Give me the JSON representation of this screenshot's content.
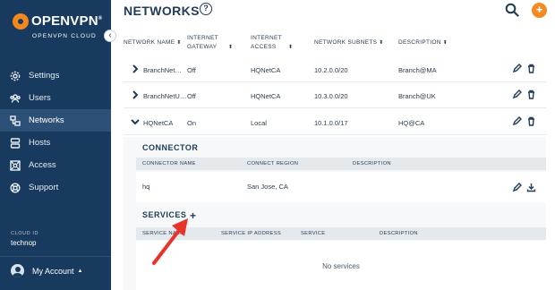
{
  "brand": {
    "name": "OPENVPN",
    "registered": "®",
    "subtitle": "OPENVPN CLOUD"
  },
  "sidebar": {
    "items": [
      {
        "label": "Settings",
        "icon": "gear-icon"
      },
      {
        "label": "Users",
        "icon": "users-icon"
      },
      {
        "label": "Networks",
        "icon": "networks-icon",
        "active": true
      },
      {
        "label": "Hosts",
        "icon": "hosts-icon"
      },
      {
        "label": "Access",
        "icon": "access-icon"
      },
      {
        "label": "Support",
        "icon": "support-icon"
      }
    ],
    "cloud_id_label": "CLOUD ID",
    "cloud_id": "technop",
    "account_label": "My Account"
  },
  "header": {
    "title": "NETWORKS",
    "help": "?",
    "add": "+"
  },
  "table": {
    "columns": [
      {
        "label": "NETWORK NAME",
        "sortable": true
      },
      {
        "label": "INTERNET GATEWAY",
        "sortable": true
      },
      {
        "label": "INTERNET ACCESS",
        "sortable": true
      },
      {
        "label": "NETWORK SUBNETS",
        "sortable": true
      },
      {
        "label": "DESCRIPTION",
        "sortable": true
      }
    ],
    "rows": [
      {
        "name": "BranchNet…",
        "gateway": "Off",
        "access": "HQNetCA",
        "subnets": "10.2.0.0/20",
        "description": "Branch@MA",
        "expanded": false
      },
      {
        "name": "BranchNetU…",
        "gateway": "Off",
        "access": "HQNetCA",
        "subnets": "10.3.0.0/20",
        "description": "Branch@UK",
        "expanded": false
      },
      {
        "name": "HQNetCA",
        "gateway": "On",
        "access": "Local",
        "subnets": "10.1.0.0/17",
        "description": "HQ@CA",
        "expanded": true
      }
    ]
  },
  "connector": {
    "title": "CONNECTOR",
    "columns": [
      "CONNECTOR NAME",
      "CONNECT REGION",
      "DESCRIPTION"
    ],
    "rows": [
      {
        "name": "hq",
        "region": "San Jose, CA",
        "description": ""
      }
    ]
  },
  "services": {
    "title": "SERVICES",
    "add": "+",
    "columns": [
      "SERVICE NAME",
      "SERVICE IP ADDRESS",
      "SERVICE",
      "DESCRIPTION"
    ],
    "empty": "No services"
  },
  "colors": {
    "sidebar": "#173a5e",
    "accent": "#f28b22",
    "arrow": "#e8332a"
  }
}
